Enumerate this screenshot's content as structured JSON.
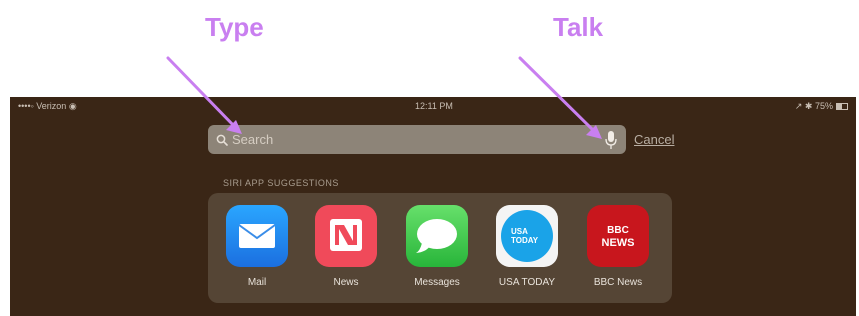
{
  "annotations": {
    "type_label": "Type",
    "talk_label": "Talk",
    "arrow_color": "#c97ff0"
  },
  "status_bar": {
    "carrier": "••••◦ Verizon ◉",
    "time": "12:11 PM",
    "battery": "↗ ✱ 75%"
  },
  "search": {
    "placeholder": "Search",
    "value": "",
    "search_icon": "magnifier-icon",
    "mic_icon": "microphone-icon"
  },
  "cancel_label": "Cancel",
  "suggestions": {
    "title": "SIRI APP SUGGESTIONS",
    "apps": [
      {
        "name": "Mail",
        "icon": "mail-icon",
        "color": "#1b8cf0"
      },
      {
        "name": "News",
        "icon": "news-icon",
        "color": "#f04a5a"
      },
      {
        "name": "Messages",
        "icon": "messages-icon",
        "color": "#3cc84a"
      },
      {
        "name": "USA TODAY",
        "icon": "usa-today-icon",
        "color": "#1aa3e8"
      },
      {
        "name": "BBC News",
        "icon": "bbc-news-icon",
        "color": "#c8161d"
      }
    ],
    "bbc_icon_text": [
      "BBC",
      "NEWS"
    ],
    "usa_icon_text": [
      "USA",
      "TODAY"
    ]
  },
  "colors": {
    "background": "#3a2616",
    "search_field": "#8d8478",
    "panel": "#554535"
  }
}
